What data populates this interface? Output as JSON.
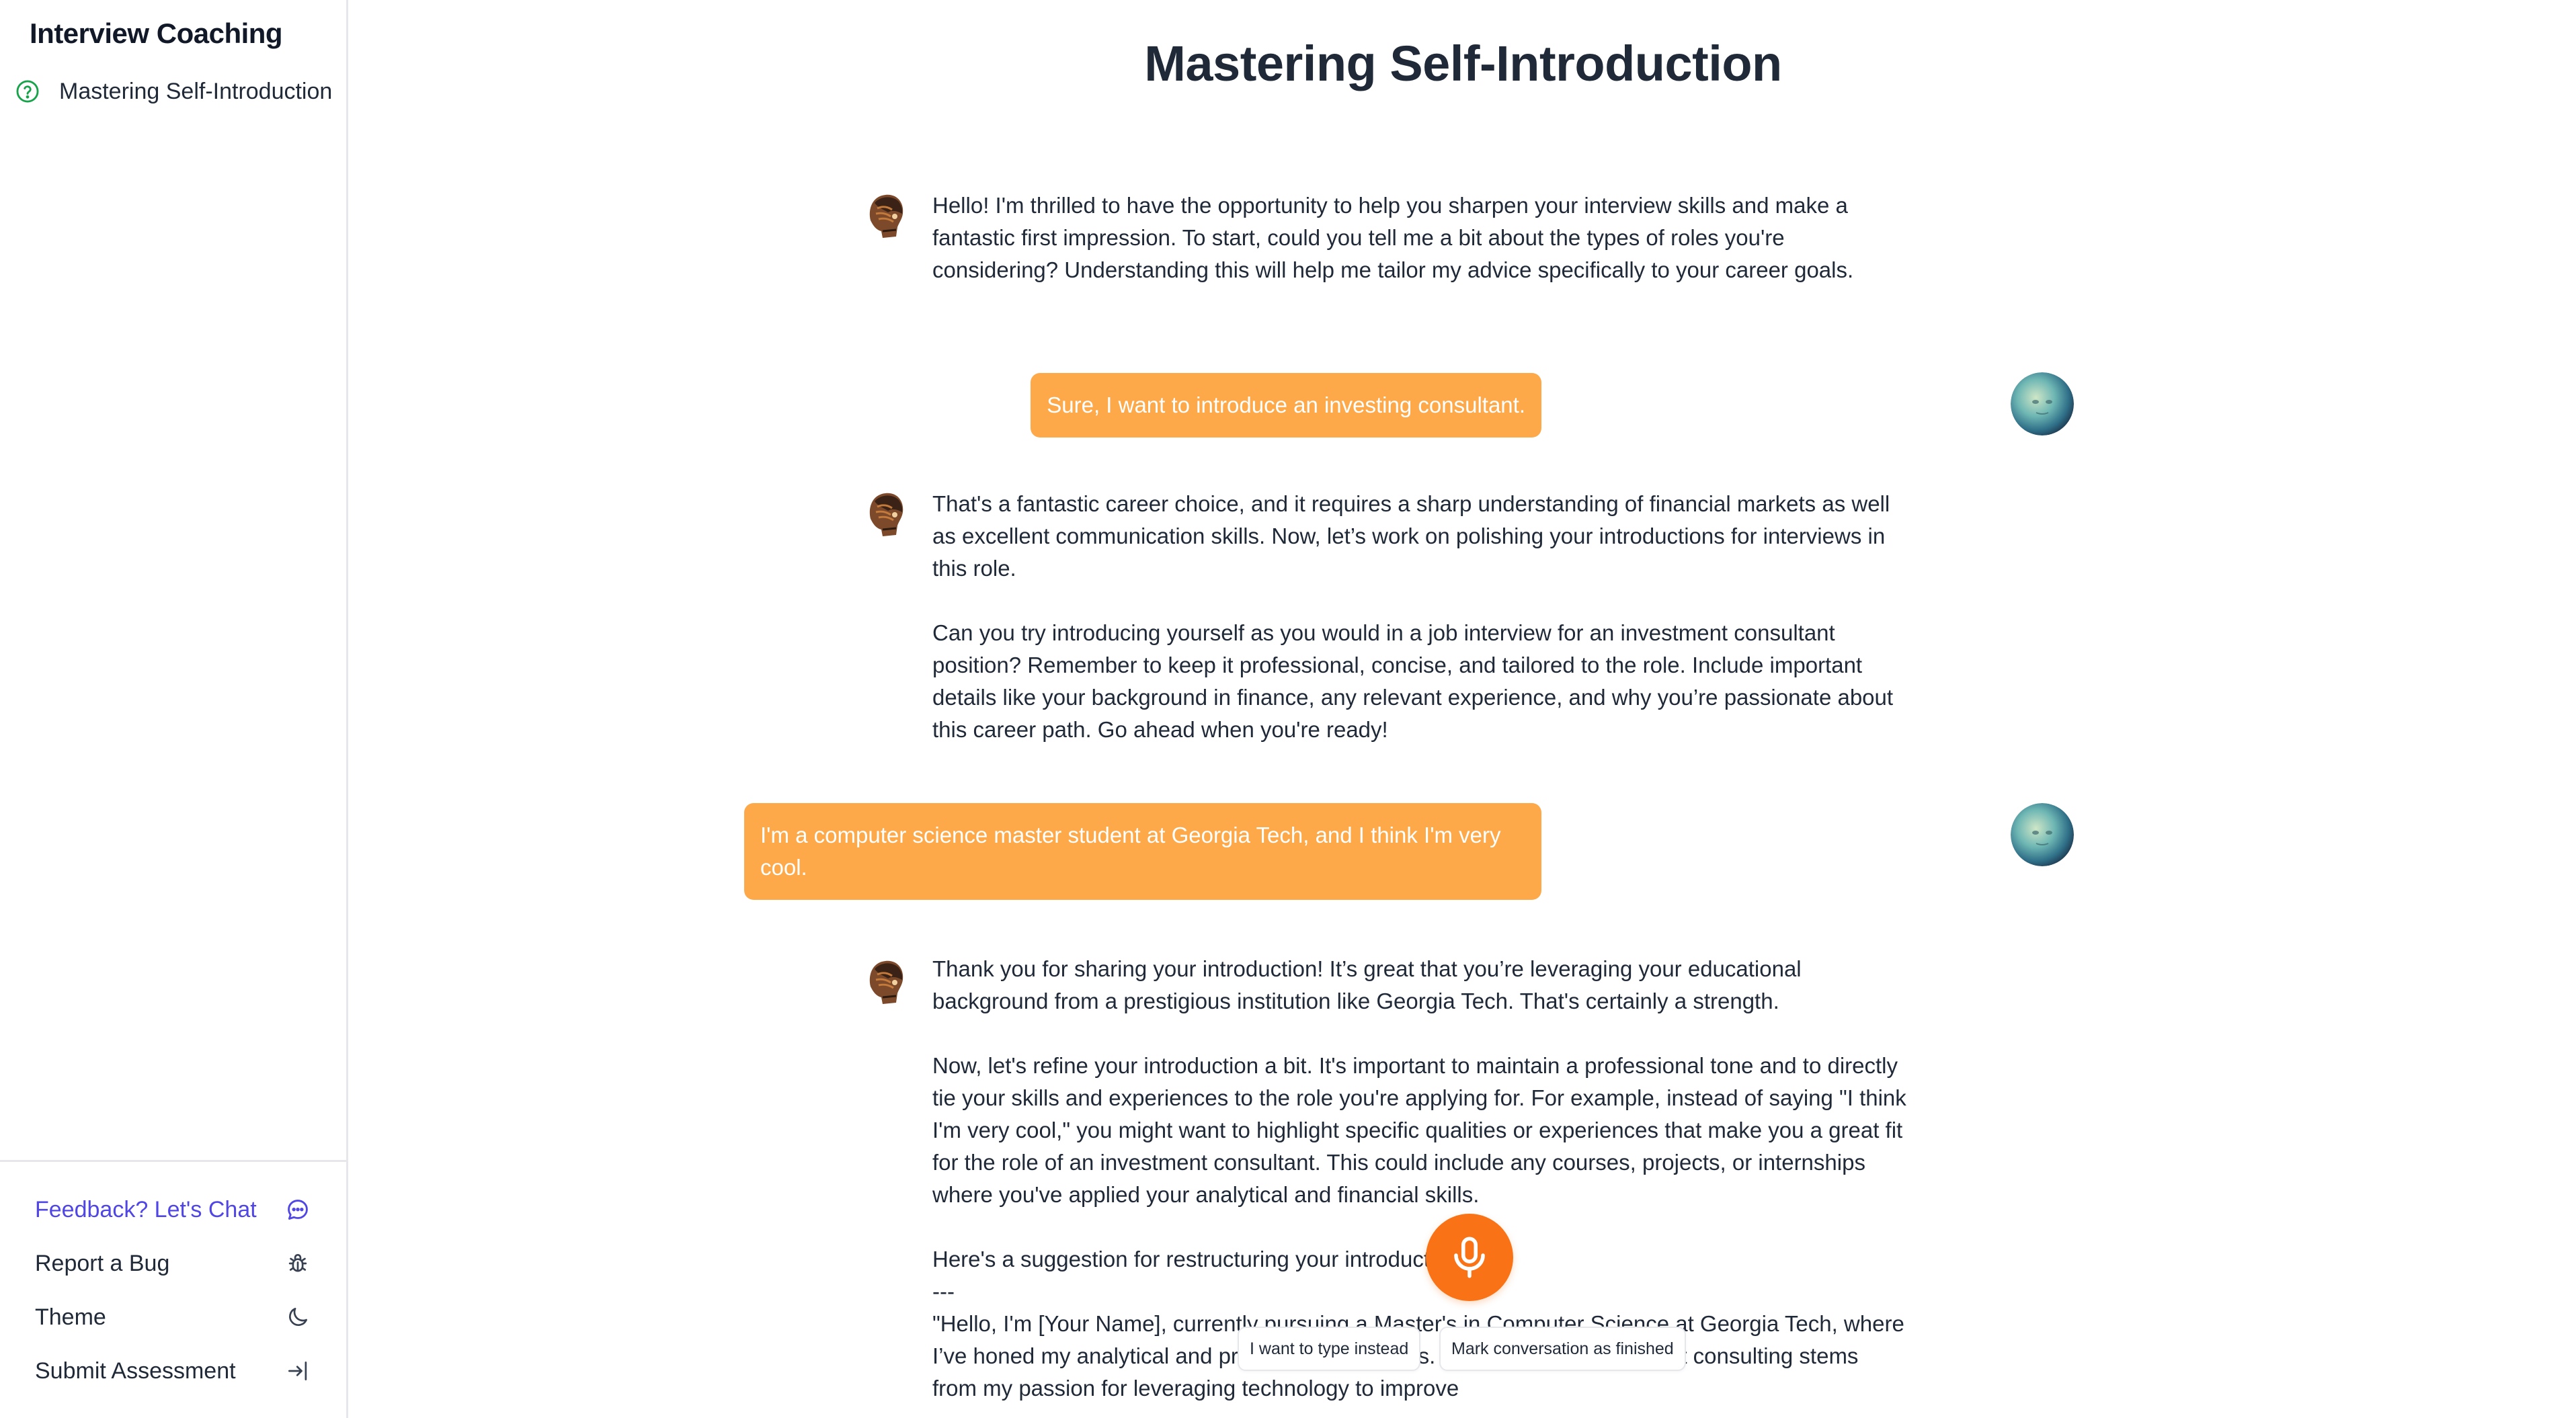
{
  "sidebar": {
    "brand": "Interview Coaching",
    "topics": [
      {
        "label": "Mastering Self-Introduction",
        "icon": "question-circle-icon"
      }
    ],
    "menu": {
      "feedback": "Feedback? Let's Chat",
      "report_bug": "Report a Bug",
      "theme": "Theme",
      "submit": "Submit Assessment"
    }
  },
  "main": {
    "title": "Mastering Self-Introduction",
    "messages": {
      "bot1": "Hello! I'm thrilled to have the opportunity to help you sharpen your interview skills and make a fantastic first impression. To start, could you tell me a bit about the types of roles you're considering? Understanding this will help me tailor my advice specifically to your career goals.",
      "user1": "Sure, I want to introduce an investing consultant.",
      "bot2": "That's a fantastic career choice, and it requires a sharp understanding of financial markets as well as excellent communication skills. Now, let’s work on polishing your introductions for interviews in this role.\n\nCan you try introducing yourself as you would in a job interview for an investment consultant position? Remember to keep it professional, concise, and tailored to the role. Include important details like your background in finance, any relevant experience, and why you’re passionate about this career path. Go ahead when you're ready!",
      "user2": "I'm a computer science master student at Georgia Tech, and I think I'm very cool.",
      "bot3": "Thank you for sharing your introduction! It’s great that you’re leveraging your educational background from a prestigious institution like Georgia Tech. That's certainly a strength.\n\nNow, let's refine your introduction a bit. It's important to maintain a professional tone and to directly tie your skills and experiences to the role you're applying for. For example, instead of saying \"I think I'm very cool,\" you might want to highlight specific qualities or experiences that make you a great fit for the role of an investment consultant. This could include any courses, projects, or internships where you've applied your analytical and financial skills.\n\nHere's a suggestion for restructuring your introduction:\n---\n\"Hello, I'm [Your Name], currently pursuing a Master's in Computer Science at Georgia Tech, where I’ve honed my analytical and problem-solving skills. My interest in investment consulting stems from my passion for leveraging technology to improve"
    },
    "actions": {
      "type_instead": "I want to type instead",
      "finish": "Mark conversation as finished"
    }
  },
  "colors": {
    "accent": "#4f46e5",
    "user_bubble": "#fda94a",
    "mic": "#f97316",
    "topic_icon": "#16a34a"
  }
}
